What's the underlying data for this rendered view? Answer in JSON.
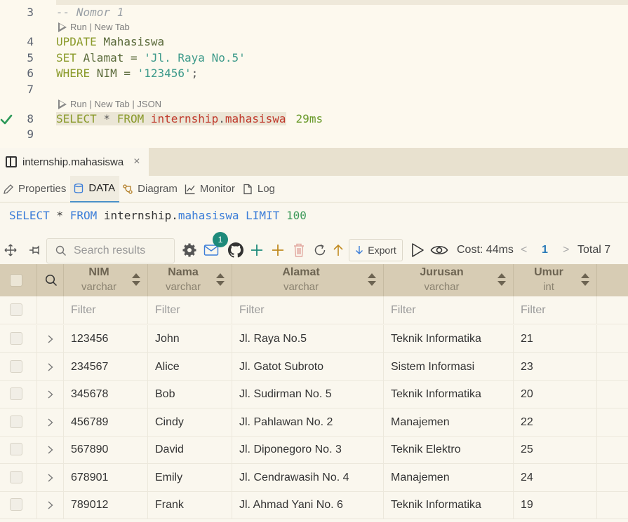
{
  "editor": {
    "lines": [
      {
        "num": "3",
        "comment": "-- Nomor 1"
      },
      {
        "num": "4",
        "kw": "UPDATE",
        "rest": " Mahasiswa"
      },
      {
        "num": "5",
        "kw": "SET",
        "rest": " Alamat = ",
        "str": "'Jl. Raya No.5'"
      },
      {
        "num": "6",
        "kw": "WHERE",
        "rest": " NIM = ",
        "str": "'123456'",
        "end": ";"
      },
      {
        "num": "7"
      },
      {
        "num": "8",
        "kw1": "SELECT",
        "mid": " * ",
        "kw2": "FROM",
        "schema": " internship",
        "dot": ".",
        "table": "mahasiswa",
        "timing": "29ms"
      },
      {
        "num": "9"
      }
    ],
    "codelens_1": "Run | New Tab",
    "codelens_2": "Run | New Tab | JSON"
  },
  "result_tab": {
    "title": "internship.mahasiswa",
    "close": "×"
  },
  "subtabs": [
    {
      "label": "Properties",
      "icon": "pencil-icon"
    },
    {
      "label": "DATA",
      "icon": "database-icon",
      "active": true
    },
    {
      "label": "Diagram",
      "icon": "diagram-icon"
    },
    {
      "label": "Monitor",
      "icon": "chart-icon"
    },
    {
      "label": "Log",
      "icon": "file-icon"
    }
  ],
  "query": {
    "select": "SELECT",
    "star": " * ",
    "from": "FROM",
    "schema": " internship.",
    "table": "mahasiswa",
    "limit": " LIMIT ",
    "limit_val": "100"
  },
  "toolbar": {
    "search_placeholder": "Search results",
    "badge": "1",
    "export_label": "Export",
    "cost": "Cost: 44ms",
    "page_prev": "<",
    "page": "1",
    "page_next": ">",
    "total": "Total 7"
  },
  "grid": {
    "columns": [
      {
        "name": "NIM",
        "type": "varchar"
      },
      {
        "name": "Nama",
        "type": "varchar"
      },
      {
        "name": "Alamat",
        "type": "varchar"
      },
      {
        "name": "Jurusan",
        "type": "varchar"
      },
      {
        "name": "Umur",
        "type": "int"
      }
    ],
    "filter_placeholder": "Filter",
    "rows": [
      [
        "123456",
        "John",
        "Jl. Raya No.5",
        "Teknik Informatika",
        "21"
      ],
      [
        "234567",
        "Alice",
        "Jl. Gatot Subroto",
        "Sistem Informasi",
        "23"
      ],
      [
        "345678",
        "Bob",
        "Jl. Sudirman No. 5",
        "Teknik Informatika",
        "20"
      ],
      [
        "456789",
        "Cindy",
        "Jl. Pahlawan No. 2",
        "Manajemen",
        "22"
      ],
      [
        "567890",
        "David",
        "Jl. Diponegoro No. 3",
        "Teknik Elektro",
        "25"
      ],
      [
        "678901",
        "Emily",
        "Jl. Cendrawasih No. 4",
        "Manajemen",
        "24"
      ],
      [
        "789012",
        "Frank",
        "Jl. Ahmad Yani No. 6",
        "Teknik Informatika",
        "19"
      ]
    ]
  }
}
